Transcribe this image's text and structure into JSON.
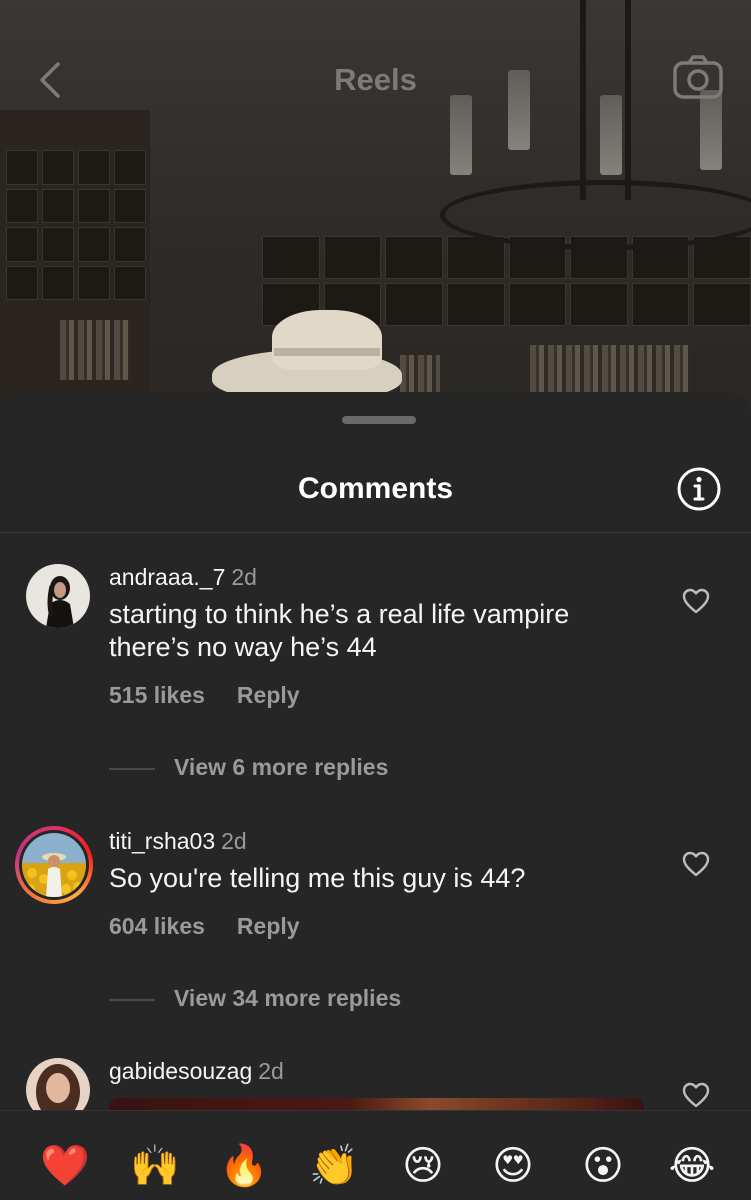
{
  "header": {
    "title": "Reels"
  },
  "sheet": {
    "title": "Comments"
  },
  "comments": [
    {
      "username": "andraaa._7",
      "time": "2d",
      "text": "starting to think he’s a real life vampire there’s no way he’s 44",
      "likes": "515 likes",
      "reply": "Reply",
      "view_replies": "View 6 more replies"
    },
    {
      "username": "titi_rsha03",
      "time": "2d",
      "text": "So you're telling me this guy is 44?",
      "likes": "604 likes",
      "reply": "Reply",
      "view_replies": "View 34 more replies"
    },
    {
      "username": "gabidesouzag",
      "time": "2d"
    }
  ],
  "emoji_bar": [
    "❤️",
    "🙌",
    "🔥",
    "👏",
    "😢",
    "😍",
    "😮",
    "😂"
  ]
}
